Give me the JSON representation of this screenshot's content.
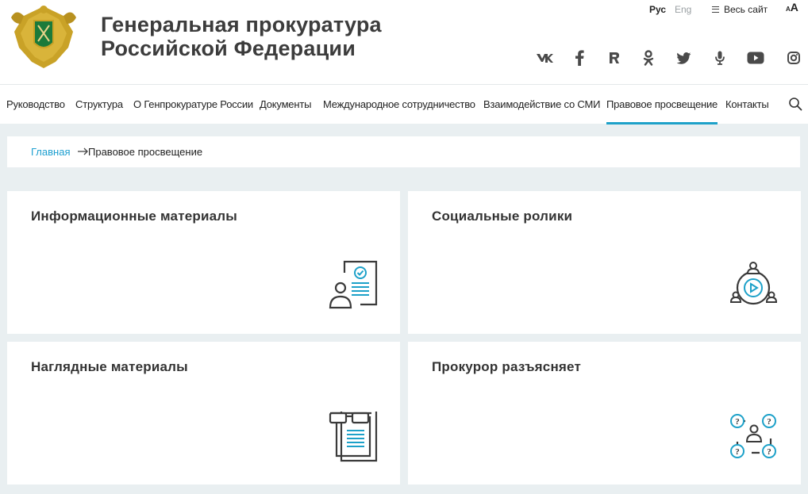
{
  "header": {
    "title_line1": "Генеральная прокуратура",
    "title_line2": "Российской Федерации",
    "lang_ru": "Рус",
    "lang_en": "Eng",
    "sitemap_label": "Весь сайт",
    "font_small": "A",
    "font_big": "A",
    "social": [
      "vk-icon",
      "facebook-icon",
      "rutube-icon",
      "odnoklassniki-icon",
      "twitter-icon",
      "podcast-icon",
      "youtube-icon",
      "instagram-icon"
    ]
  },
  "nav": {
    "items": [
      {
        "label": "Руководство"
      },
      {
        "label": "Структура"
      },
      {
        "label": "О Генпрокуратуре России"
      },
      {
        "label": "Документы"
      },
      {
        "label": "Международное сотрудничество"
      },
      {
        "label": "Взаимодействие со СМИ"
      },
      {
        "label": "Правовое просвещение"
      },
      {
        "label": "Контакты"
      }
    ],
    "active_index": 6
  },
  "breadcrumb": {
    "home": "Главная",
    "current": "Правовое просвещение"
  },
  "cards": [
    {
      "title": "Информационные материалы",
      "icon": "document-person-icon"
    },
    {
      "title": "Социальные ролики",
      "icon": "video-people-icon"
    },
    {
      "title": "Наглядные материалы",
      "icon": "glasses-document-icon"
    },
    {
      "title": "Прокурор разъясняет",
      "icon": "person-questions-icon"
    }
  ],
  "colors": {
    "accent": "#1da1c9",
    "link": "#1d9fd0",
    "background": "#e9eff1",
    "icon_dark": "#3a3a3a"
  }
}
